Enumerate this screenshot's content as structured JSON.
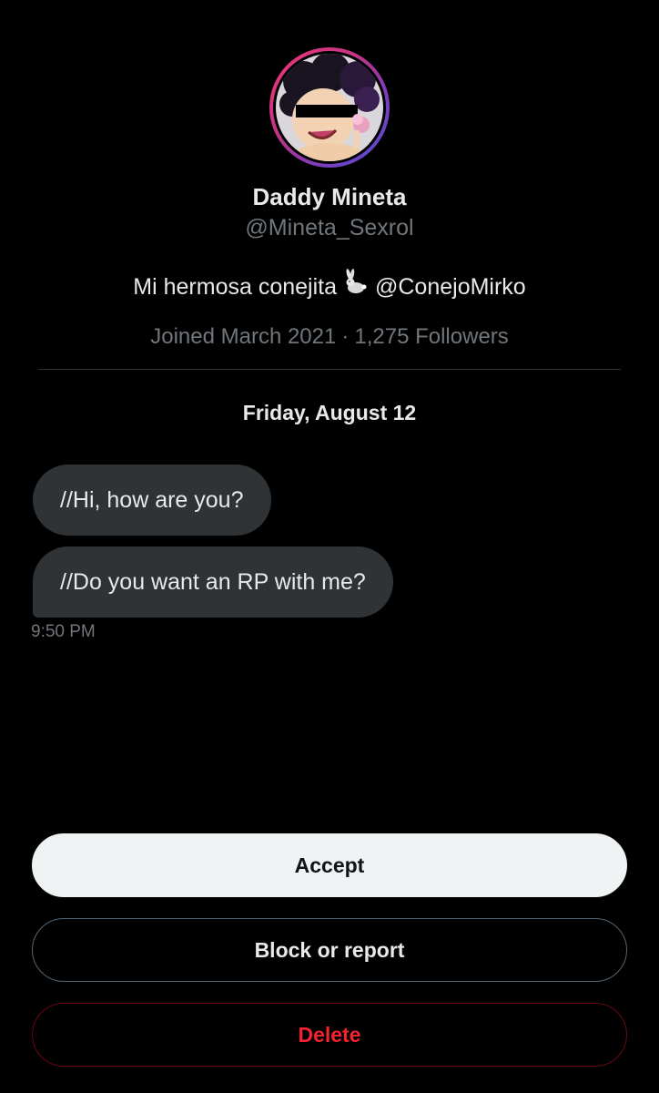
{
  "profile": {
    "display_name": "Daddy Mineta",
    "handle": "@Mineta_Sexrol",
    "bio_text": "Mi hermosa conejita",
    "bio_emoji_icon": "rabbit-icon",
    "bio_mention": "@ConejoMirko",
    "joined": "Joined March 2021",
    "separator": "·",
    "followers": "1,275 Followers",
    "avatar_icon": "profile-avatar"
  },
  "conversation": {
    "date": "Friday, August 12",
    "messages": [
      {
        "text": "//Hi, how are you?"
      },
      {
        "text": "//Do you want an RP with me?"
      }
    ],
    "timestamp": "9:50 PM"
  },
  "actions": {
    "accept_label": "Accept",
    "block_label": "Block or report",
    "delete_label": "Delete"
  },
  "colors": {
    "background": "#000000",
    "bubble": "#2f3336",
    "muted_text": "#71767b",
    "primary_text": "#e7e9ea",
    "danger": "#f4212e",
    "accept_bg": "#eff3f4"
  }
}
